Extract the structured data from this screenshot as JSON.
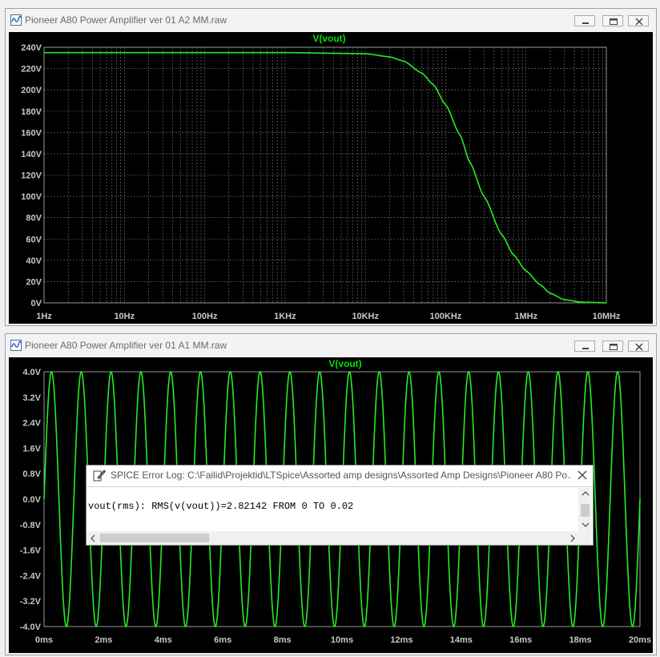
{
  "window_top": {
    "title": "Pioneer A80 Power Amplifier ver 01 A2 MM.raw",
    "trace_name": "V(vout)",
    "y_ticks": [
      "240V",
      "220V",
      "200V",
      "180V",
      "160V",
      "140V",
      "120V",
      "100V",
      "80V",
      "60V",
      "40V",
      "20V",
      "0V"
    ],
    "x_ticks": [
      "1Hz",
      "10Hz",
      "100Hz",
      "1KHz",
      "10KHz",
      "100KHz",
      "1MHz",
      "10MHz"
    ]
  },
  "window_bottom": {
    "title": "Pioneer A80 Power Amplifier ver 01 A1 MM.raw",
    "trace_name": "V(vout)",
    "y_ticks": [
      "4.0V",
      "3.2V",
      "2.4V",
      "1.6V",
      "0.8V",
      "0.0V",
      "-0.8V",
      "-1.6V",
      "-2.4V",
      "-3.2V",
      "-4.0V"
    ],
    "x_ticks": [
      "0ms",
      "2ms",
      "4ms",
      "6ms",
      "8ms",
      "10ms",
      "12ms",
      "14ms",
      "16ms",
      "18ms",
      "20ms"
    ]
  },
  "error_log": {
    "title": "SPICE Error Log: C:\\Failid\\Projektid\\LTSpice\\Assorted amp designs\\Assorted Amp Designs\\Pioneer A80 Po...",
    "message": "vout(rms): RMS(v(vout))=2.82142 FROM 0 TO 0.02"
  },
  "chart_data": [
    {
      "type": "line",
      "title": "V(vout)",
      "x_scale": "log",
      "xlim": [
        "1Hz",
        "10MHz"
      ],
      "ylim": [
        0,
        240
      ],
      "y_unit": "V",
      "grid": true,
      "series": [
        {
          "name": "V(vout)",
          "x": [
            1,
            10,
            100,
            1000,
            10000,
            20000,
            30000,
            50000,
            70000,
            100000,
            150000,
            200000,
            300000,
            500000,
            700000,
            1000000,
            1500000,
            2000000,
            3000000,
            5000000,
            10000000
          ],
          "y": [
            235,
            235,
            235,
            235,
            234,
            231,
            227,
            216,
            205,
            186,
            158,
            132,
            100,
            64,
            45,
            30,
            17,
            9,
            3,
            0.6,
            0
          ]
        }
      ]
    },
    {
      "type": "line",
      "title": "V(vout)",
      "xlim": [
        0,
        20
      ],
      "x_unit": "ms",
      "ylim": [
        -4.0,
        4.0
      ],
      "y_unit": "V",
      "grid": false,
      "series": [
        {
          "name": "V(vout)",
          "waveform": "sine",
          "amplitude": 4.0,
          "frequency_hz": 1000,
          "phase_start": 0
        }
      ]
    }
  ]
}
